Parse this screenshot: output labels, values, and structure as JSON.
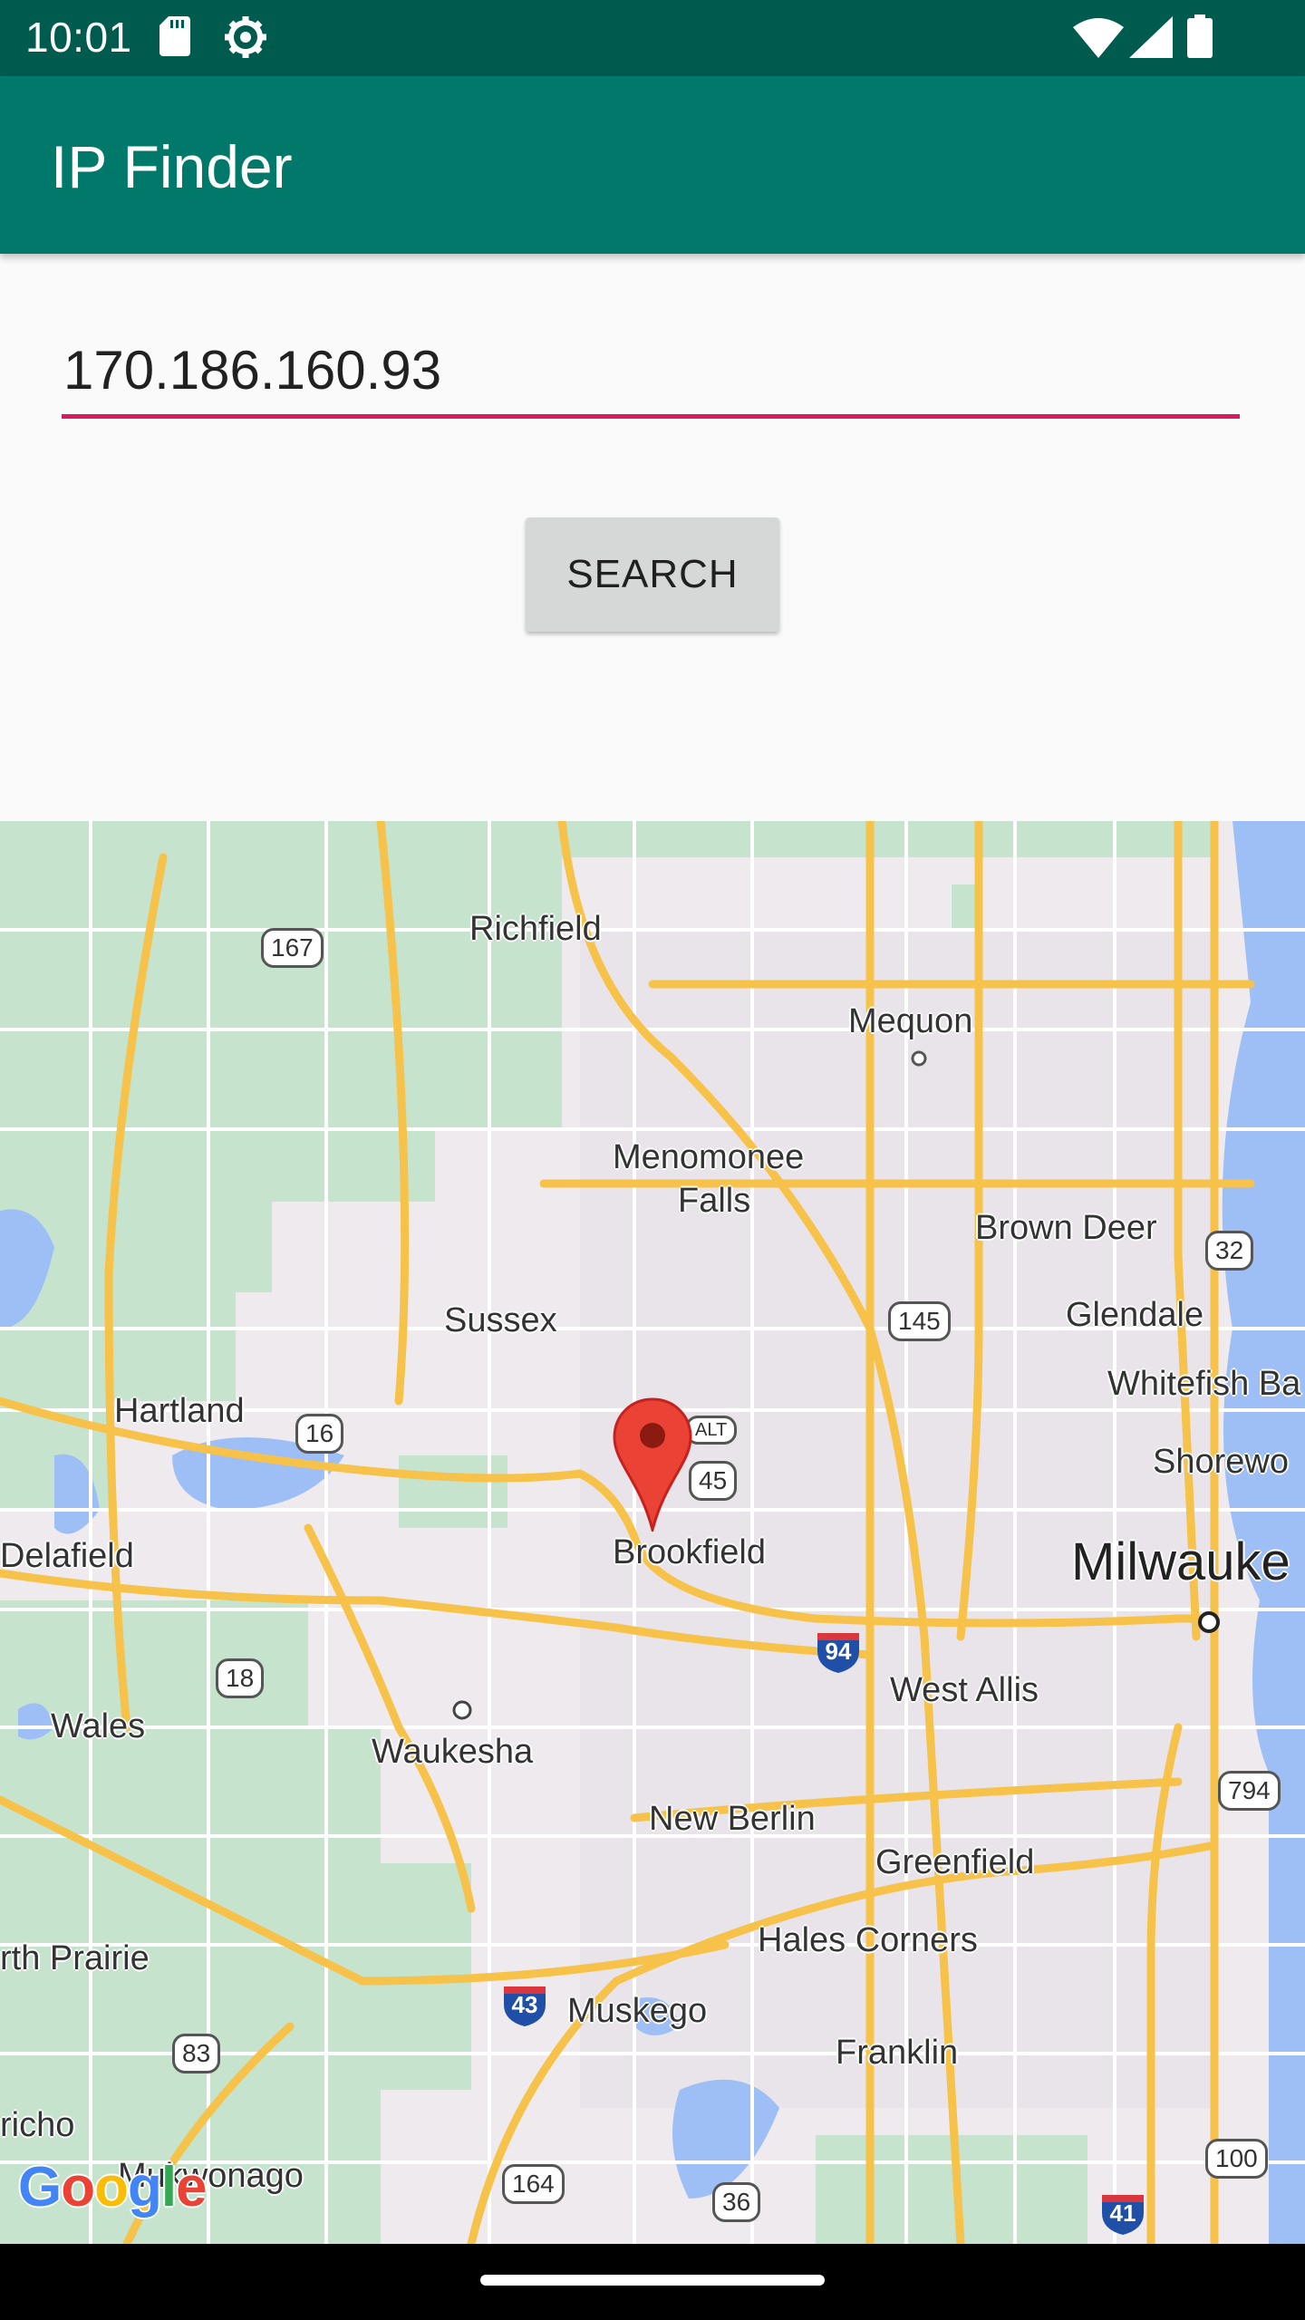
{
  "status_bar": {
    "time": "10:01",
    "icons": [
      "sd-card-icon",
      "gear-icon",
      "wifi-icon",
      "signal-icon",
      "battery-icon"
    ]
  },
  "app_bar": {
    "title": "IP Finder",
    "color": "#00796b"
  },
  "form": {
    "ip_value": "170.186.160.93",
    "search_label": "SEARCH",
    "accent_color": "#d81b60"
  },
  "map": {
    "places": {
      "richfield": "Richfield",
      "mequon": "Mequon",
      "menomonee_falls_1": "Menomonee",
      "menomonee_falls_2": "Falls",
      "brown_deer": "Brown Deer",
      "sussex": "Sussex",
      "glendale": "Glendale",
      "whitefish_bay": "Whitefish Ba",
      "hartland": "Hartland",
      "shorewood": "Shorewo",
      "delafield": "Delafield",
      "brookfield": "Brookfield",
      "milwaukee": "Milwauke",
      "west_allis": "West Allis",
      "wales": "Wales",
      "waukesha": "Waukesha",
      "new_berlin": "New Berlin",
      "greenfield": "Greenfield",
      "hales_corners": "Hales Corners",
      "north_prairie": "rth Prairie",
      "muskego": "Muskego",
      "franklin": "Franklin",
      "jericho": "richo",
      "mukwonago": "Mukwonago"
    },
    "shields": {
      "r167": "167",
      "r32": "32",
      "r145": "145",
      "r16": "16",
      "alt": "ALT",
      "r45": "45",
      "r18": "18",
      "r794": "794",
      "r83": "83",
      "r164": "164",
      "r36": "36",
      "r100": "100"
    },
    "interstates": {
      "i94": "94",
      "i43": "43",
      "i41": "41"
    },
    "logo": "Google",
    "marker": "location-pin-icon"
  }
}
